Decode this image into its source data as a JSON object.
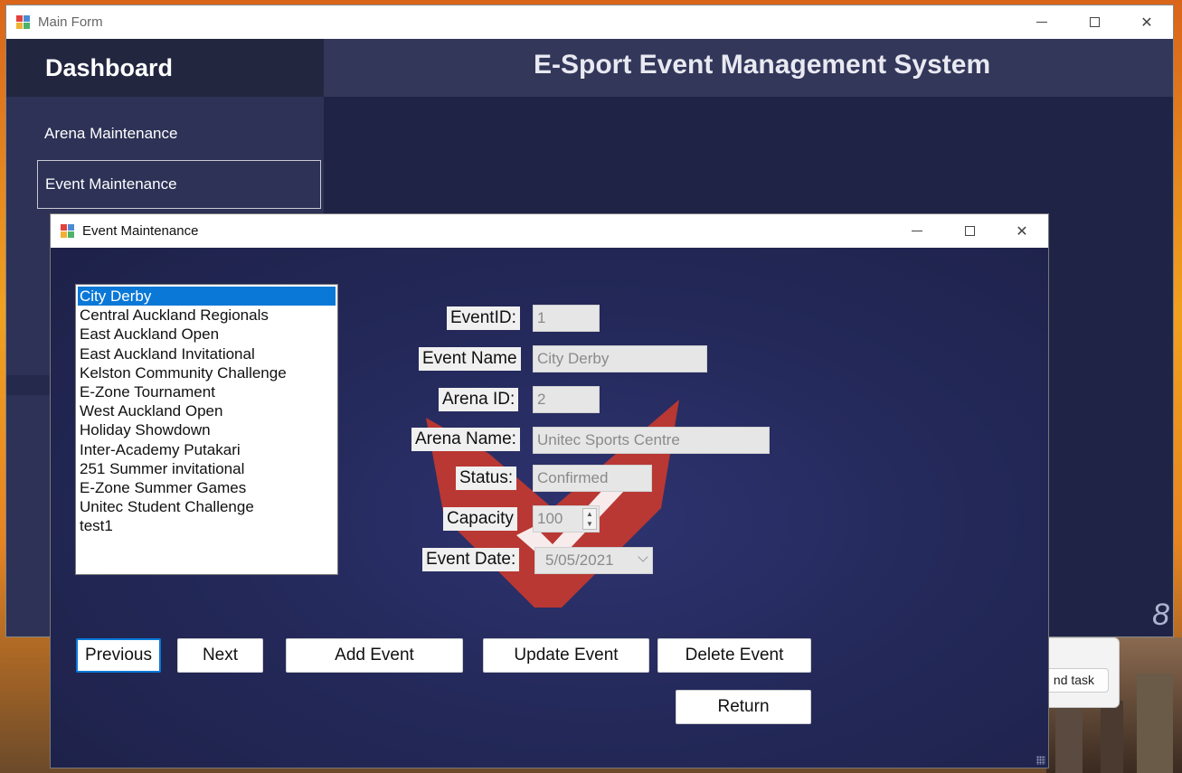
{
  "main_window": {
    "title": "Main Form",
    "header": "E-Sport Event Management System",
    "sidebar": {
      "heading": "Dashboard",
      "items": [
        {
          "label": "Arena Maintenance"
        },
        {
          "label": "Event Maintenance"
        }
      ]
    }
  },
  "dialog": {
    "title": "Event Maintenance",
    "events": [
      "City Derby",
      "Central Auckland Regionals",
      "East Auckland Open",
      "East Auckland Invitational",
      "Kelston Community Challenge",
      "E-Zone Tournament",
      "West Auckland Open",
      "Holiday Showdown",
      "Inter-Academy Putakari",
      "251 Summer invitational",
      "E-Zone Summer Games",
      "Unitec Student Challenge",
      "test1"
    ],
    "selected_event": "City Derby",
    "fields": {
      "event_id": {
        "label": "EventID:",
        "value": "1"
      },
      "event_name": {
        "label": "Event Name",
        "value": "City Derby"
      },
      "arena_id": {
        "label": "Arena ID:",
        "value": "2"
      },
      "arena_name": {
        "label": "Arena Name:",
        "value": "Unitec Sports Centre"
      },
      "status": {
        "label": "Status:",
        "value": "Confirmed"
      },
      "capacity": {
        "label": "Capacity",
        "value": "100"
      },
      "event_date": {
        "label": "Event Date:",
        "value": "5/05/2021"
      }
    },
    "buttons": {
      "previous": "Previous",
      "next": "Next",
      "add": "Add Event",
      "update": "Update Event",
      "delete": "Delete Event",
      "return": "Return"
    }
  },
  "background_task": {
    "button_label": "nd task"
  },
  "colors": {
    "dialog_bg": "#232858",
    "sidebar_bg": "#2d3256",
    "selection": "#0a78d7"
  }
}
